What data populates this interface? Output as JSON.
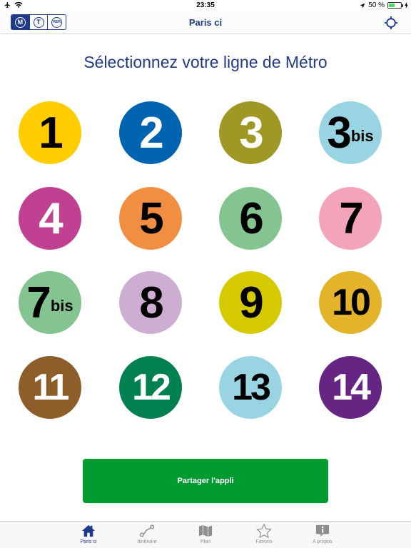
{
  "status": {
    "time": "23:35",
    "battery": "50 %",
    "battery_level": 0.5
  },
  "nav": {
    "title": "Paris ci",
    "modes": [
      {
        "label": "M",
        "active": true
      },
      {
        "label": "T",
        "active": false
      },
      {
        "label": "RER",
        "active": false
      }
    ]
  },
  "heading": "Sélectionnez votre ligne de Métro",
  "lines": [
    {
      "number": "1",
      "suffix": "",
      "bg": "#ffcd00",
      "fg": "#000000"
    },
    {
      "number": "2",
      "suffix": "",
      "bg": "#0064b1",
      "fg": "#ffffff"
    },
    {
      "number": "3",
      "suffix": "",
      "bg": "#9f9825",
      "fg": "#ffffff"
    },
    {
      "number": "3",
      "suffix": "bis",
      "bg": "#98d4e2",
      "fg": "#000000"
    },
    {
      "number": "4",
      "suffix": "",
      "bg": "#c04191",
      "fg": "#ffffff"
    },
    {
      "number": "5",
      "suffix": "",
      "bg": "#f28e42",
      "fg": "#000000"
    },
    {
      "number": "6",
      "suffix": "",
      "bg": "#83c491",
      "fg": "#000000"
    },
    {
      "number": "7",
      "suffix": "",
      "bg": "#f3a4ba",
      "fg": "#000000"
    },
    {
      "number": "7",
      "suffix": "bis",
      "bg": "#83c491",
      "fg": "#000000"
    },
    {
      "number": "8",
      "suffix": "",
      "bg": "#ceadd2",
      "fg": "#000000"
    },
    {
      "number": "9",
      "suffix": "",
      "bg": "#d5c900",
      "fg": "#000000"
    },
    {
      "number": "10",
      "suffix": "",
      "bg": "#e3b32a",
      "fg": "#000000"
    },
    {
      "number": "11",
      "suffix": "",
      "bg": "#8d5e2a",
      "fg": "#ffffff"
    },
    {
      "number": "12",
      "suffix": "",
      "bg": "#00814f",
      "fg": "#ffffff"
    },
    {
      "number": "13",
      "suffix": "",
      "bg": "#98d4e2",
      "fg": "#000000"
    },
    {
      "number": "14",
      "suffix": "",
      "bg": "#662483",
      "fg": "#ffffff"
    }
  ],
  "share_label": "Partager l'appli",
  "tabs": [
    {
      "label": "Paris ci",
      "icon": "home-icon",
      "active": true
    },
    {
      "label": "Itinéraire",
      "icon": "route-icon",
      "active": false
    },
    {
      "label": "Plan",
      "icon": "map-icon",
      "active": false
    },
    {
      "label": "Favoris",
      "icon": "star-icon",
      "active": false
    },
    {
      "label": "A propos",
      "icon": "info-icon",
      "active": false
    }
  ],
  "colors": {
    "accent": "#1f3a8a",
    "share": "#009b2f"
  }
}
